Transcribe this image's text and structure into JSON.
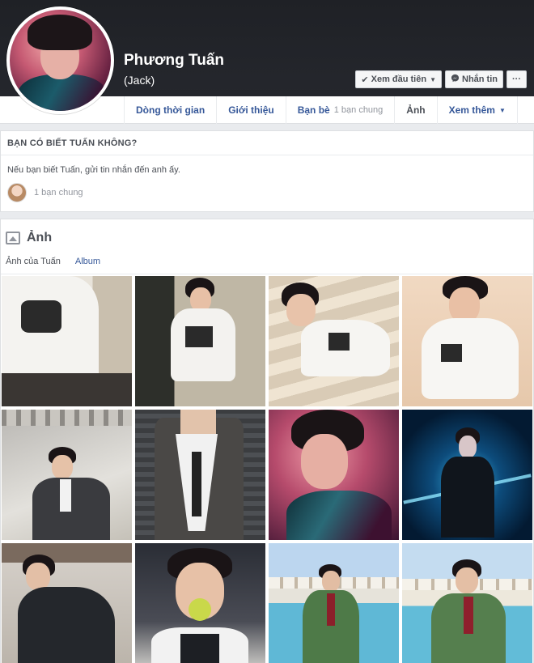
{
  "profile": {
    "name": "Phương Tuấn",
    "alternate_name": "(Jack)"
  },
  "cover_actions": {
    "see_first": {
      "label": "Xem đầu tiên",
      "icon": "check-icon"
    },
    "message": {
      "label": "Nhắn tin",
      "icon": "messenger-icon"
    },
    "more": {
      "label": "···"
    }
  },
  "nav": {
    "tabs": [
      {
        "label": "Dòng thời gian"
      },
      {
        "label": "Giới thiệu"
      },
      {
        "label": "Bạn bè",
        "sub": "1 bạn chung"
      },
      {
        "label": "Ảnh"
      },
      {
        "label": "Xem thêm"
      }
    ]
  },
  "know_card": {
    "title": "BẠN CÓ BIẾT TUẤN KHÔNG?",
    "message": "Nếu bạn biết Tuấn, gửi tin nhắn đến anh ấy.",
    "mutual": "1 bạn chung"
  },
  "photos": {
    "title": "Ảnh",
    "tabs": [
      {
        "label": "Ảnh của Tuấn"
      },
      {
        "label": "Album"
      }
    ],
    "count": 12
  }
}
